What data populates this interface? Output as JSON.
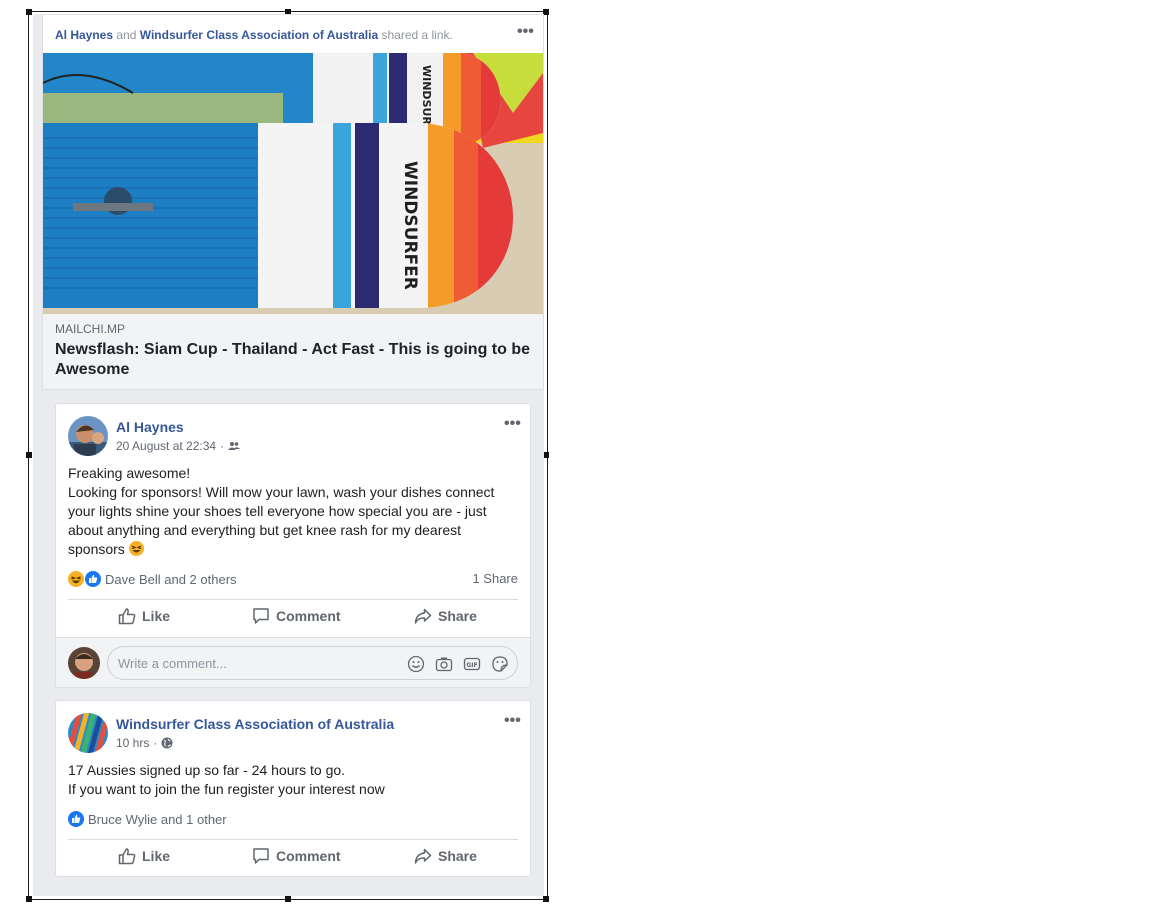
{
  "shared_post": {
    "actor_1": "Al Haynes",
    "connector": "and",
    "actor_2": "Windsurfer Class Association of Australia",
    "action": "shared a link.",
    "brand_text": "WINDSURFER",
    "link_domain": "MAILCHI.MP",
    "link_title": "Newsflash: Siam Cup - Thailand - Act Fast - This is going to be Awesome"
  },
  "post1": {
    "author": "Al Haynes",
    "timestamp": "20 August at 22:34",
    "audience_icon": "friends-icon",
    "lines": [
      "Freaking awesome!",
      "Looking for sponsors! Will mow your lawn, wash your dishes connect",
      "your lights shine your shoes tell everyone how special you are - just",
      "about anything and everything but get knee rash for my dearest",
      "sponsors"
    ],
    "reactions_text": "Dave Bell and 2 others",
    "shares_text": "1 Share",
    "actions": {
      "like": "Like",
      "comment": "Comment",
      "share": "Share"
    },
    "comment_placeholder": "Write a comment..."
  },
  "post2": {
    "author": "Windsurfer Class Association of Australia",
    "timestamp": "10 hrs",
    "audience_icon": "globe-icon",
    "lines": [
      "17 Aussies signed up so far - 24 hours to go.",
      "If you want to join the fun register your interest now"
    ],
    "reactions_text": "Bruce Wylie and 1 other",
    "actions": {
      "like": "Like",
      "comment": "Comment",
      "share": "Share"
    }
  },
  "colors": {
    "link_blue": "#365899",
    "like_blue": "#1877f2",
    "haha_yellow": "#f7b125",
    "feed_bg": "#e9ebee",
    "muted_text": "#606770"
  }
}
